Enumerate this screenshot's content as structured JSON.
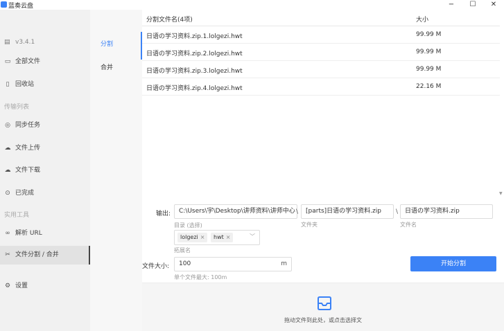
{
  "app": {
    "title": "蓝奏云盘",
    "version": "v3.4.1",
    "window_controls": {
      "minimize": "−",
      "maximize": "☐",
      "close": "✕"
    }
  },
  "sidebar": {
    "items_top": [
      {
        "label": "全部文件",
        "icon": "folder-icon"
      },
      {
        "label": "回收站",
        "icon": "trash-icon"
      }
    ],
    "section_transfer": "传输列表",
    "items_transfer": [
      {
        "label": "同步任务",
        "icon": "eye-icon"
      },
      {
        "label": "文件上传",
        "icon": "cloud-upload-icon"
      },
      {
        "label": "文件下载",
        "icon": "cloud-download-icon"
      },
      {
        "label": "已完成",
        "icon": "check-circle-icon"
      }
    ],
    "section_tools": "实用工具",
    "items_tools": [
      {
        "label": "解析 URL",
        "icon": "link-icon"
      },
      {
        "label": "文件分割 / 合并",
        "icon": "scissors-icon"
      }
    ],
    "settings": {
      "label": "设置",
      "icon": "gear-icon"
    }
  },
  "subnav": {
    "split": "分割",
    "merge": "合并"
  },
  "table": {
    "headers": {
      "name": "分割文件名(4项)",
      "size": "大小"
    },
    "rows": [
      {
        "name": "日语の学习资料.zip.1.lolgezi.hwt",
        "size": "99.99 M"
      },
      {
        "name": "日语の学习资料.zip.2.lolgezi.hwt",
        "size": "99.99 M"
      },
      {
        "name": "日语の学习资料.zip.3.lolgezi.hwt",
        "size": "99.99 M"
      },
      {
        "name": "日语の学习资料.zip.4.lolgezi.hwt",
        "size": "22.16 M"
      }
    ]
  },
  "output": {
    "label": "输出:",
    "dir_value": "C:\\Users\\宇\\Desktop\\讲师资料\\讲师中心",
    "dir_hint": "目录 (选择)",
    "sep": "\\",
    "folder_value": "[parts]日语の学习资料.zip",
    "folder_hint": "文件夹",
    "filename_value": "日语の学习资料.zip",
    "filename_hint": "文件名",
    "ext_tags": [
      "lolgezi",
      "hwt"
    ],
    "ext_hint": "拓展名"
  },
  "file_size": {
    "label": "文件大小:",
    "value": "100",
    "unit": "m",
    "hint": "单个文件最大: 100m"
  },
  "start_button": "开始分割",
  "dropzone": {
    "text": "拖动文件到此处，或点击选择文"
  }
}
